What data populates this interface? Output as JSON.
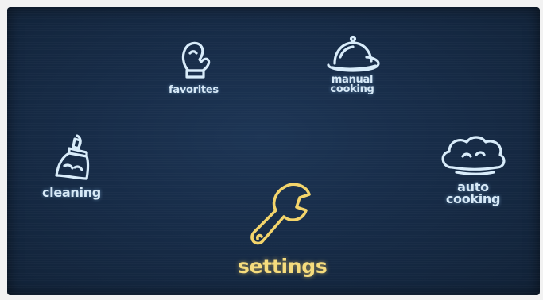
{
  "menu": {
    "favorites": {
      "label": "favorites",
      "icon": "oven-mitt-icon"
    },
    "manual_cooking": {
      "label": "manual\ncooking",
      "icon": "cloche-icon"
    },
    "cleaning": {
      "label": "cleaning",
      "icon": "brush-icon"
    },
    "auto_cooking": {
      "label": "auto\ncooking",
      "icon": "chef-hat-icon"
    },
    "settings": {
      "label": "settings",
      "icon": "wrench-icon",
      "selected": true
    }
  },
  "colors": {
    "screen_background": "#172c48",
    "icon_default": "#d8ecfa",
    "icon_selected": "#f3d46a"
  }
}
